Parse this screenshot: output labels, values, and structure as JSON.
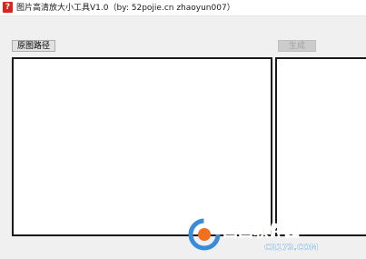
{
  "window": {
    "title": "图片高清放大小工具V1.0（by:  52pojie.cn zhaoyun007）",
    "icon": "app-icon",
    "icon_glyph": "?"
  },
  "toolbar": {
    "source_path_label": "原图路径",
    "generate_label": "生成",
    "generate_enabled": false
  },
  "watermark": {
    "brand": "西西软件园",
    "site": "CR173.COM"
  },
  "colors": {
    "titlebar_bg": "#ffffff",
    "window_bg": "#f0f0f0",
    "panel_border": "#1a1a1a",
    "app_icon": "#d8261c",
    "watermark_orange": "#f36f1c",
    "watermark_blue": "#3a8bd8"
  }
}
